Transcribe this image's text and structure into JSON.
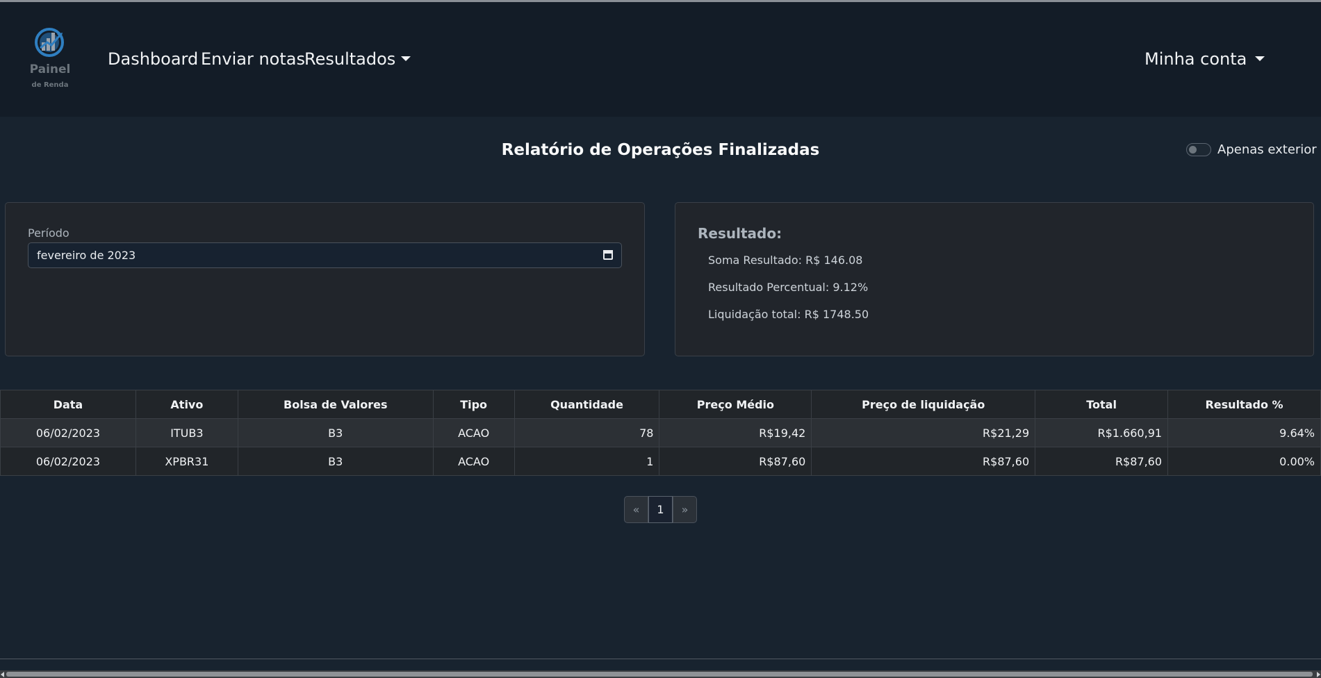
{
  "navbar": {
    "logo": {
      "icon": "bar-chart-globe-logo",
      "line1": "Painel",
      "line2": "de Renda"
    },
    "links": [
      "Dashboard",
      "Enviar notas",
      "Resultados"
    ],
    "account": "Minha conta"
  },
  "page": {
    "title": "Relatório de Operações Finalizadas",
    "toggle_label": "Apenas exterior"
  },
  "filter": {
    "label": "Período",
    "value": "fevereiro de 2023"
  },
  "summary": {
    "title": "Resultado:",
    "soma": "Soma Resultado: R$ 146.08",
    "percentual": "Resultado Percentual: 9.12%",
    "liquidacao": "Liquidação total: R$ 1748.50"
  },
  "table": {
    "headers": [
      "Data",
      "Ativo",
      "Bolsa de Valores",
      "Tipo",
      "Quantidade",
      "Preço Médio",
      "Preço de liquidação",
      "Total",
      "Resultado %"
    ],
    "rows": [
      [
        "06/02/2023",
        "ITUB3",
        "B3",
        "ACAO",
        "78",
        "R$19,42",
        "R$21,29",
        "R$1.660,91",
        "9.64%"
      ],
      [
        "06/02/2023",
        "XPBR31",
        "B3",
        "ACAO",
        "1",
        "R$87,60",
        "R$87,60",
        "R$87,60",
        "0.00%"
      ]
    ]
  },
  "pagination": {
    "prev": "«",
    "current": "1",
    "next": "»"
  },
  "colors": {
    "background": "#18232f",
    "navbar": "#131c27",
    "card": "#21252b",
    "logo_blue": "#2f7fc1"
  }
}
